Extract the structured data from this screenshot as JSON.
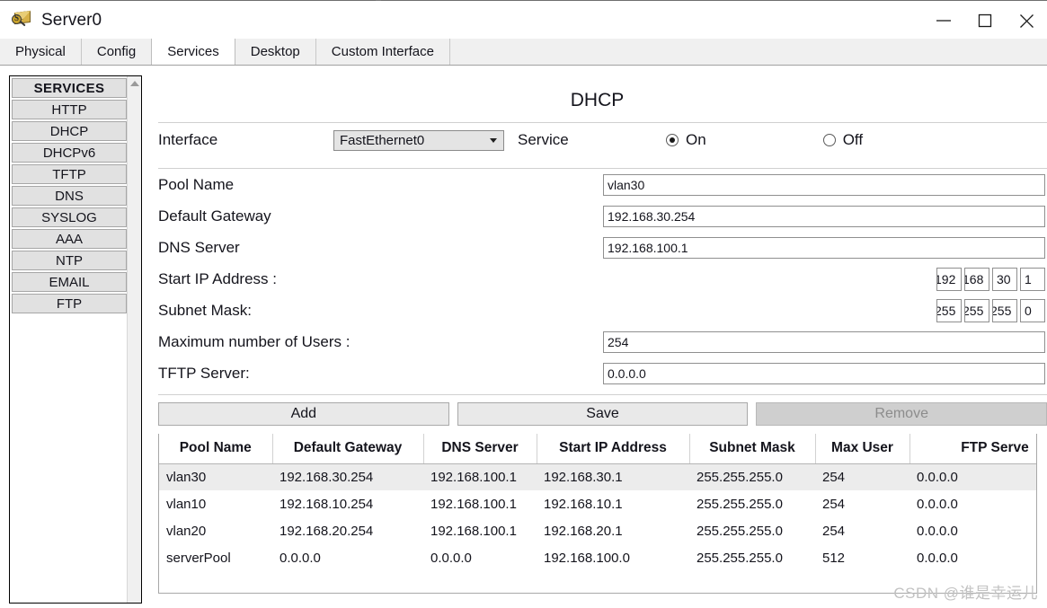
{
  "window": {
    "title": "Server0",
    "icon": "server-magnifier-icon",
    "minimize_label": "minimize-icon",
    "maximize_label": "maximize-icon",
    "close_label": "close-icon"
  },
  "tabs": [
    {
      "label": "Physical",
      "active": false
    },
    {
      "label": "Config",
      "active": false
    },
    {
      "label": "Services",
      "active": true
    },
    {
      "label": "Desktop",
      "active": false
    },
    {
      "label": "Custom Interface",
      "active": false
    }
  ],
  "sidebar": {
    "header": "SERVICES",
    "items": [
      {
        "label": "HTTP"
      },
      {
        "label": "DHCP"
      },
      {
        "label": "DHCPv6"
      },
      {
        "label": "TFTP"
      },
      {
        "label": "DNS"
      },
      {
        "label": "SYSLOG"
      },
      {
        "label": "AAA"
      },
      {
        "label": "NTP"
      },
      {
        "label": "EMAIL"
      },
      {
        "label": "FTP"
      }
    ],
    "scroll_up_icon": "chevron-up-icon"
  },
  "panel": {
    "title": "DHCP",
    "interface_label": "Interface",
    "interface_value": "FastEthernet0",
    "service_label": "Service",
    "service_on_label": "On",
    "service_off_label": "Off",
    "service_state": "On"
  },
  "form": {
    "pool_name_label": "Pool Name",
    "pool_name_value": "vlan30",
    "default_gateway_label": "Default Gateway",
    "default_gateway_value": "192.168.30.254",
    "dns_server_label": "DNS Server",
    "dns_server_value": "192.168.100.1",
    "start_ip_label": "Start IP Address :",
    "start_ip_octets": [
      "192",
      "168",
      "30",
      "1"
    ],
    "subnet_mask_label": "Subnet Mask:",
    "subnet_mask_octets": [
      "255",
      "255",
      "255",
      "0"
    ],
    "max_users_label": "Maximum number of Users :",
    "max_users_value": "254",
    "tftp_server_label": "TFTP Server:",
    "tftp_server_value": "0.0.0.0"
  },
  "buttons": {
    "add": "Add",
    "save": "Save",
    "remove": "Remove",
    "remove_disabled": true
  },
  "table": {
    "columns": [
      "Pool Name",
      "Default Gateway",
      "DNS Server",
      "Start IP Address",
      "Subnet Mask",
      "Max User",
      "FTP Serve"
    ],
    "rows": [
      {
        "selected": true,
        "cells": [
          "vlan30",
          "192.168.30.254",
          "192.168.100.1",
          "192.168.30.1",
          "255.255.255.0",
          "254",
          "0.0.0.0"
        ]
      },
      {
        "selected": false,
        "cells": [
          "vlan10",
          "192.168.10.254",
          "192.168.100.1",
          "192.168.10.1",
          "255.255.255.0",
          "254",
          "0.0.0.0"
        ]
      },
      {
        "selected": false,
        "cells": [
          "vlan20",
          "192.168.20.254",
          "192.168.100.1",
          "192.168.20.1",
          "255.255.255.0",
          "254",
          "0.0.0.0"
        ]
      },
      {
        "selected": false,
        "cells": [
          "serverPool",
          "0.0.0.0",
          "0.0.0.0",
          "192.168.100.0",
          "255.255.255.0",
          "512",
          "0.0.0.0"
        ]
      }
    ]
  },
  "watermark": "CSDN @谁是幸运儿"
}
